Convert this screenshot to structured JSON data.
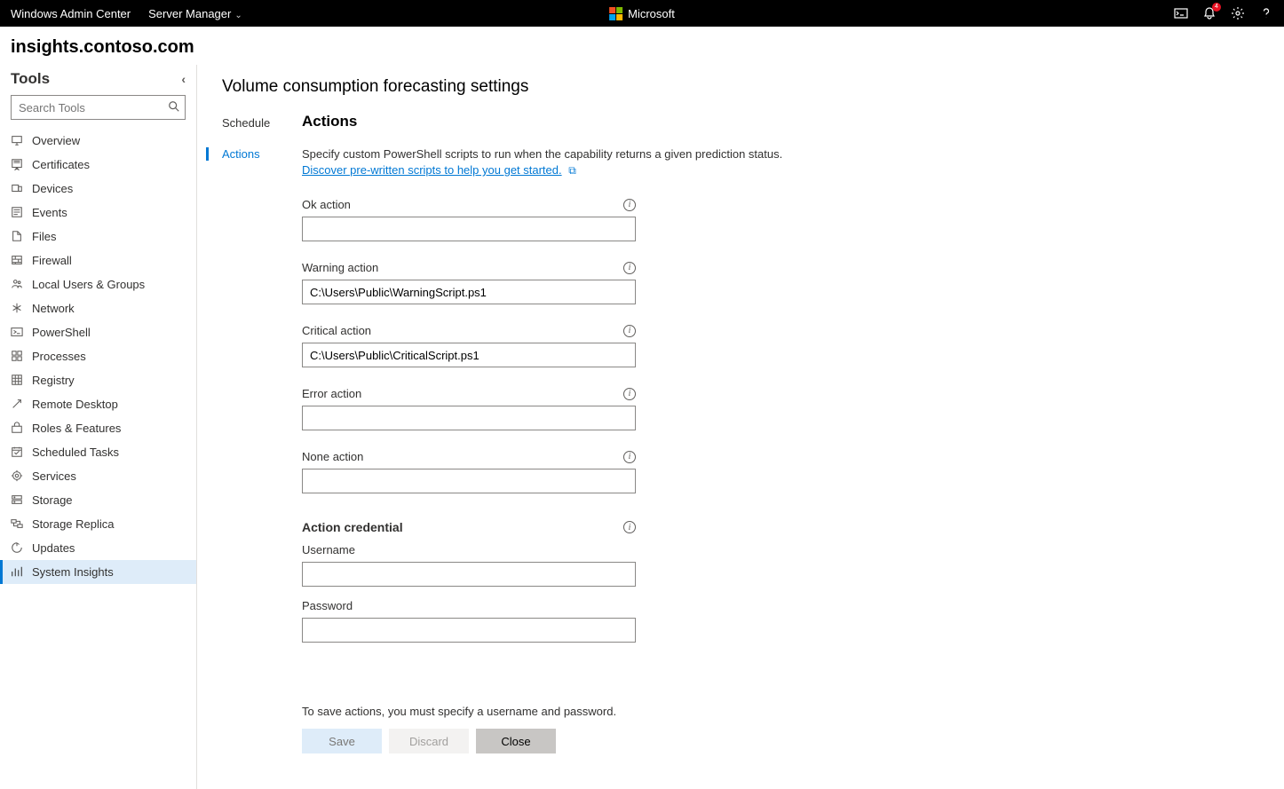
{
  "topbar": {
    "app_name": "Windows Admin Center",
    "context_menu": "Server Manager",
    "brand": "Microsoft",
    "notification_count": "4"
  },
  "host": "insights.contoso.com",
  "sidebar": {
    "heading": "Tools",
    "search_placeholder": "Search Tools",
    "items": [
      {
        "label": "Overview",
        "icon": "monitor"
      },
      {
        "label": "Certificates",
        "icon": "certificate"
      },
      {
        "label": "Devices",
        "icon": "devices"
      },
      {
        "label": "Events",
        "icon": "events"
      },
      {
        "label": "Files",
        "icon": "files"
      },
      {
        "label": "Firewall",
        "icon": "firewall"
      },
      {
        "label": "Local Users & Groups",
        "icon": "users"
      },
      {
        "label": "Network",
        "icon": "network"
      },
      {
        "label": "PowerShell",
        "icon": "powershell"
      },
      {
        "label": "Processes",
        "icon": "processes"
      },
      {
        "label": "Registry",
        "icon": "registry"
      },
      {
        "label": "Remote Desktop",
        "icon": "remote"
      },
      {
        "label": "Roles & Features",
        "icon": "roles"
      },
      {
        "label": "Scheduled Tasks",
        "icon": "tasks"
      },
      {
        "label": "Services",
        "icon": "services"
      },
      {
        "label": "Storage",
        "icon": "storage"
      },
      {
        "label": "Storage Replica",
        "icon": "replica"
      },
      {
        "label": "Updates",
        "icon": "updates"
      },
      {
        "label": "System Insights",
        "icon": "insights"
      }
    ],
    "active": "System Insights"
  },
  "page": {
    "title": "Volume consumption forecasting settings",
    "tabs": [
      {
        "label": "Schedule"
      },
      {
        "label": "Actions"
      }
    ],
    "active_tab": "Actions",
    "section_head": "Actions",
    "description": "Specify custom PowerShell scripts to run when the capability returns a given prediction status.",
    "link_text": "Discover pre-written scripts to help you get started.",
    "fields": {
      "ok": {
        "label": "Ok action",
        "value": ""
      },
      "warning": {
        "label": "Warning action",
        "value": "C:\\Users\\Public\\WarningScript.ps1"
      },
      "critical": {
        "label": "Critical action",
        "value": "C:\\Users\\Public\\CriticalScript.ps1"
      },
      "error": {
        "label": "Error action",
        "value": ""
      },
      "none": {
        "label": "None action",
        "value": ""
      }
    },
    "credential": {
      "heading": "Action credential",
      "username_label": "Username",
      "username_value": "",
      "password_label": "Password",
      "password_value": ""
    },
    "save_note": "To save actions, you must specify a username and password.",
    "buttons": {
      "save": "Save",
      "discard": "Discard",
      "close": "Close"
    }
  }
}
